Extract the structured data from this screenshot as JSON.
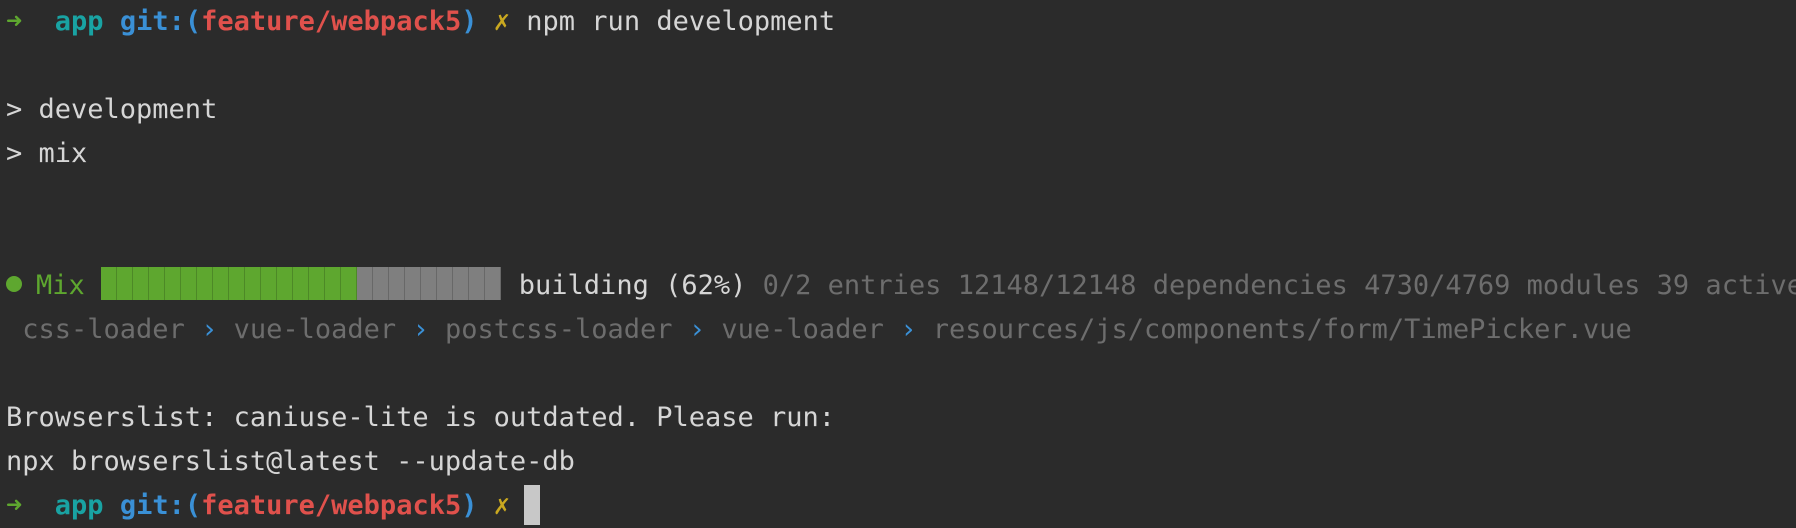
{
  "prompt": {
    "arrow": "➜",
    "dir": "app",
    "git_label": "git:",
    "paren_open": "(",
    "branch": "feature/webpack5",
    "paren_close": ")",
    "dirty_marker": "✗"
  },
  "command": "npm run development",
  "script_lines": [
    "> development",
    "> mix"
  ],
  "build": {
    "label": "Mix",
    "status": "building (62%)",
    "progress_fraction": 0.64,
    "details": "0/2 entries 12148/12148 dependencies 4730/4769 modules 39 active",
    "loaders": [
      "css-loader",
      "vue-loader",
      "postcss-loader",
      "vue-loader",
      "resources/js/components/form/TimePicker.vue"
    ],
    "separator": "›"
  },
  "warning_lines": [
    "Browserslist: caniuse-lite is outdated. Please run:",
    "npx browserslist@latest --update-db"
  ],
  "colors": {
    "background": "#2b2b2b",
    "text": "#d6d6d6",
    "green": "#5ea72f",
    "teal": "#19a3a3",
    "blue": "#3a90d6",
    "red": "#e0514c",
    "yellow": "#c9a820",
    "dim": "#6d6d6d",
    "progress_empty": "#7f7f7f"
  }
}
